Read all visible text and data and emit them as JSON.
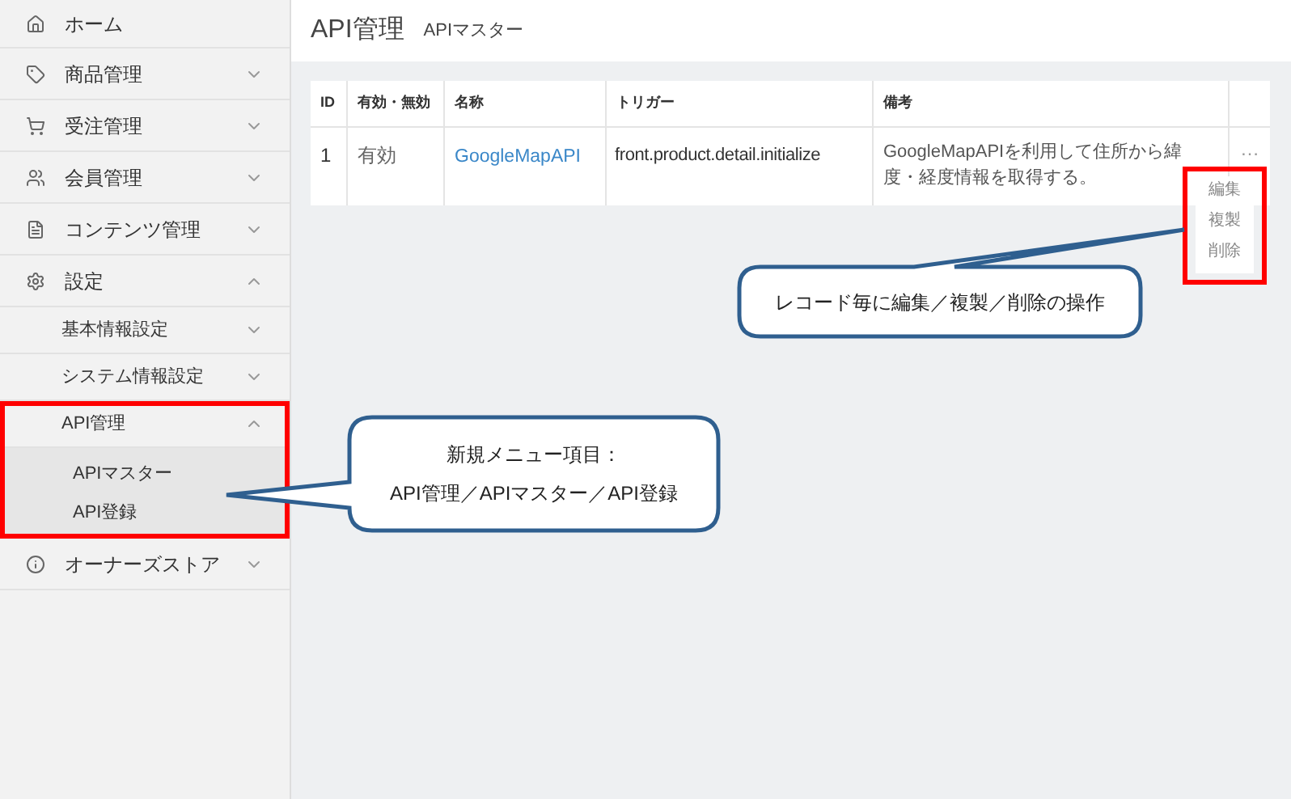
{
  "sidebar": {
    "items": [
      {
        "label": "ホーム"
      },
      {
        "label": "商品管理",
        "expanded": false
      },
      {
        "label": "受注管理",
        "expanded": false
      },
      {
        "label": "会員管理",
        "expanded": false
      },
      {
        "label": "コンテンツ管理",
        "expanded": false
      },
      {
        "label": "設定",
        "expanded": true,
        "children": [
          {
            "label": "基本情報設定",
            "expanded": false
          },
          {
            "label": "システム情報設定",
            "expanded": false
          },
          {
            "label": "API管理",
            "expanded": true,
            "children": [
              {
                "label": "APIマスター"
              },
              {
                "label": "API登録"
              }
            ]
          }
        ]
      },
      {
        "label": "オーナーズストア",
        "expanded": false
      }
    ]
  },
  "header": {
    "title": "API管理",
    "subtitle": "APIマスター"
  },
  "table": {
    "columns": [
      "ID",
      "有効・無効",
      "名称",
      "トリガー",
      "備考"
    ],
    "rows": [
      {
        "id": "1",
        "status": "有効",
        "name": "GoogleMapAPI",
        "trigger": "front.product.detail.initialize",
        "note": "GoogleMapAPIを利用して住所から緯度・経度情報を取得する。",
        "menu_button": "…"
      }
    ]
  },
  "row_menu": {
    "items": [
      "編集",
      "複製",
      "削除"
    ]
  },
  "callouts": [
    {
      "lines": [
        "レコード毎に編集／複製／削除の操作"
      ]
    },
    {
      "lines": [
        "新規メニュー項目：",
        "API管理／APIマスター／API登録"
      ]
    }
  ]
}
